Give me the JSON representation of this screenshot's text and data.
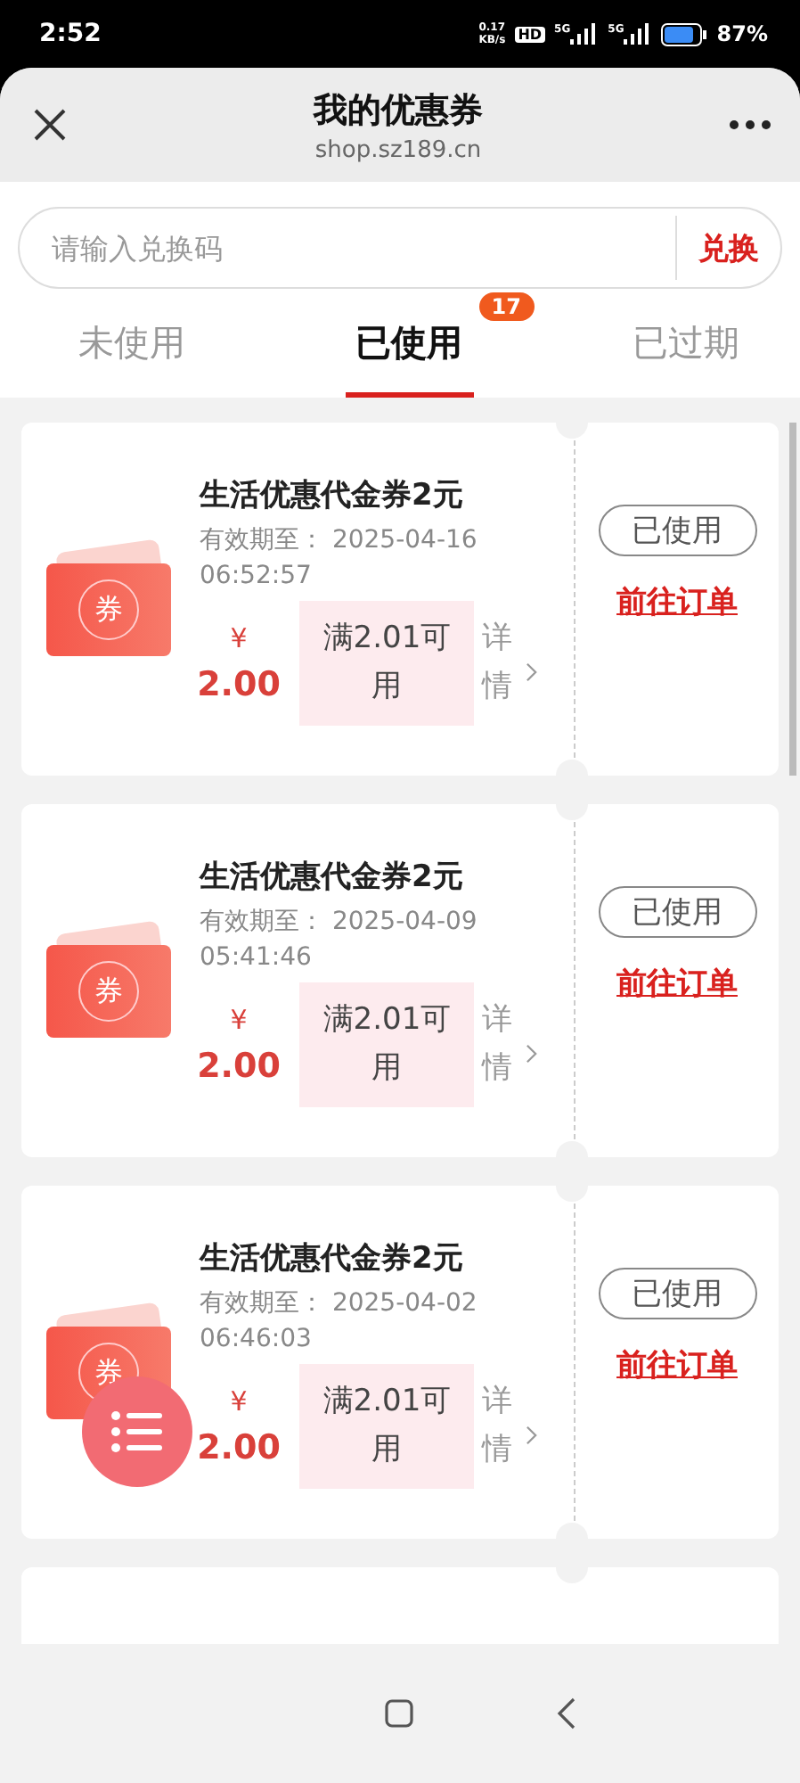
{
  "status_bar": {
    "time": "2:52",
    "net_speed": "0.17",
    "net_unit": "KB/s",
    "hd": "HD",
    "signals": [
      "5G",
      "5G"
    ],
    "battery": "87%"
  },
  "header": {
    "title": "我的优惠券",
    "subtitle": "shop.sz189.cn"
  },
  "redeem": {
    "placeholder": "请输入兑换码",
    "button": "兑换"
  },
  "tabs": [
    {
      "label": "未使用",
      "selected": false
    },
    {
      "label": "已使用",
      "selected": true,
      "badge": "17"
    },
    {
      "label": "已过期",
      "selected": false
    }
  ],
  "coupons": [
    {
      "icon_label": "券",
      "title": "生活优惠代金券2元",
      "expiry": "有效期至： 2025-04-16 06:52:57",
      "currency": "¥",
      "amount": "2.00",
      "condition": "满2.01可用",
      "details": "详情",
      "status": "已使用",
      "action": "前往订单"
    },
    {
      "icon_label": "券",
      "title": "生活优惠代金券2元",
      "expiry": "有效期至： 2025-04-09 05:41:46",
      "currency": "¥",
      "amount": "2.00",
      "condition": "满2.01可用",
      "details": "详情",
      "status": "已使用",
      "action": "前往订单"
    },
    {
      "icon_label": "券",
      "title": "生活优惠代金券2元",
      "expiry": "有效期至： 2025-04-02 06:46:03",
      "currency": "¥",
      "amount": "2.00",
      "condition": "满2.01可用",
      "details": "详情",
      "status": "已使用",
      "action": "前往订单"
    }
  ]
}
